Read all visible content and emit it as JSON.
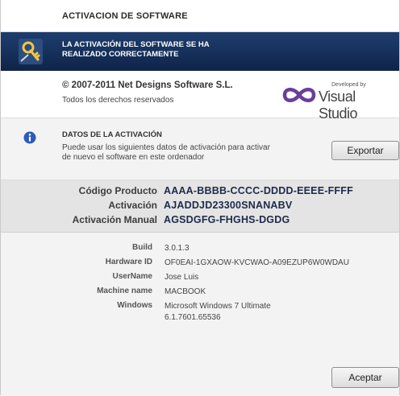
{
  "window": {
    "title": "ACTIVACION DE SOFTWARE"
  },
  "banner": {
    "message_line1": "LA ACTIVACIÓN DEL SOFTWARE SE HA",
    "message_line2": "REALIZADO CORRECTAMENTE",
    "icon": "key-icon",
    "color": "#16305a"
  },
  "about": {
    "copyright": "© 2007-2011 Net Designs Software S.L.",
    "rights": "Todos los derechos reservados",
    "developed_by": "Developed by",
    "product": "Visual Studio"
  },
  "activation_data": {
    "heading": "DATOS DE LA ACTIVACIÓN",
    "description_line1": "Puede usar los siguientes datos de activación para activar",
    "description_line2": "de nuevo el software en este ordenador",
    "export_label": "Exportar",
    "icon": "info-icon"
  },
  "codes": [
    {
      "label": "Código Producto",
      "value": "AAAA-BBBB-CCCC-DDDD-EEEE-FFFF"
    },
    {
      "label": "Activación",
      "value": "AJADDJD23300SNANABV"
    },
    {
      "label": "Activación Manual",
      "value": "AGSDGFG-FHGHS-DGDG"
    }
  ],
  "system": [
    {
      "key": "Build",
      "value": "3.0.1.3"
    },
    {
      "key": "Hardware ID",
      "value": "OF0EAI-1GXAOW-KVCWAO-A09EZUP6W0WDAU"
    },
    {
      "key": "UserName",
      "value": "Jose Luis"
    },
    {
      "key": "Machine name",
      "value": "MACBOOK"
    },
    {
      "key": "Windows",
      "value": "Microsoft Windows 7 Ultimate",
      "value2": "6.1.7601.65536"
    }
  ],
  "footer": {
    "accept_label": "Aceptar"
  }
}
